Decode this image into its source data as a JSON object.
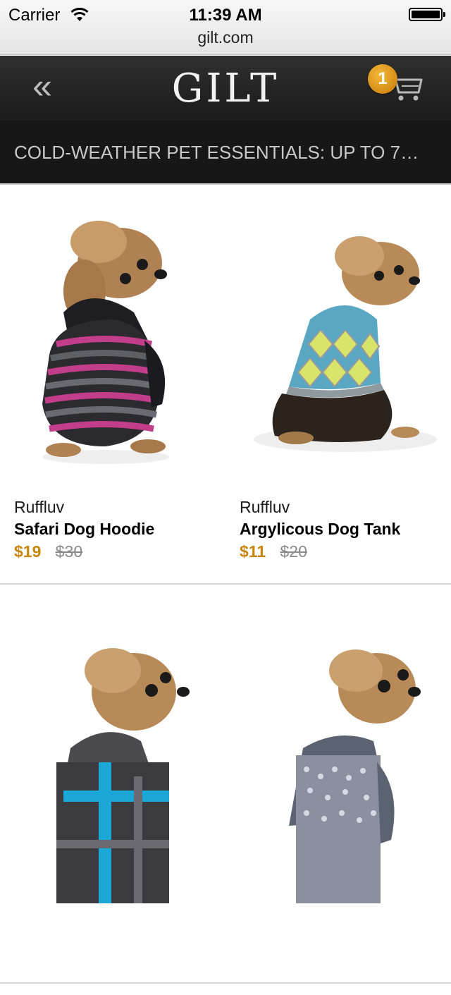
{
  "status_bar": {
    "carrier": "Carrier",
    "time": "11:39 AM",
    "url": "gilt.com"
  },
  "header": {
    "back_icon": "double-chevron-left-icon",
    "logo": "GILT",
    "cart_icon": "shopping-cart-icon",
    "cart_count": "1",
    "badge_color": "#e09a18"
  },
  "sale": {
    "title": "COLD-WEATHER PET ESSENTIALS: UP TO 7…"
  },
  "products": [
    {
      "brand": "Ruffluv",
      "name": "Safari Dog Hoodie",
      "price": "$19",
      "original_price": "$30"
    },
    {
      "brand": "Ruffluv",
      "name": "Argylicous Dog Tank",
      "price": "$11",
      "original_price": "$20"
    }
  ],
  "colors": {
    "price_accent": "#c8860d",
    "header_bg": "#1f1f1f"
  }
}
